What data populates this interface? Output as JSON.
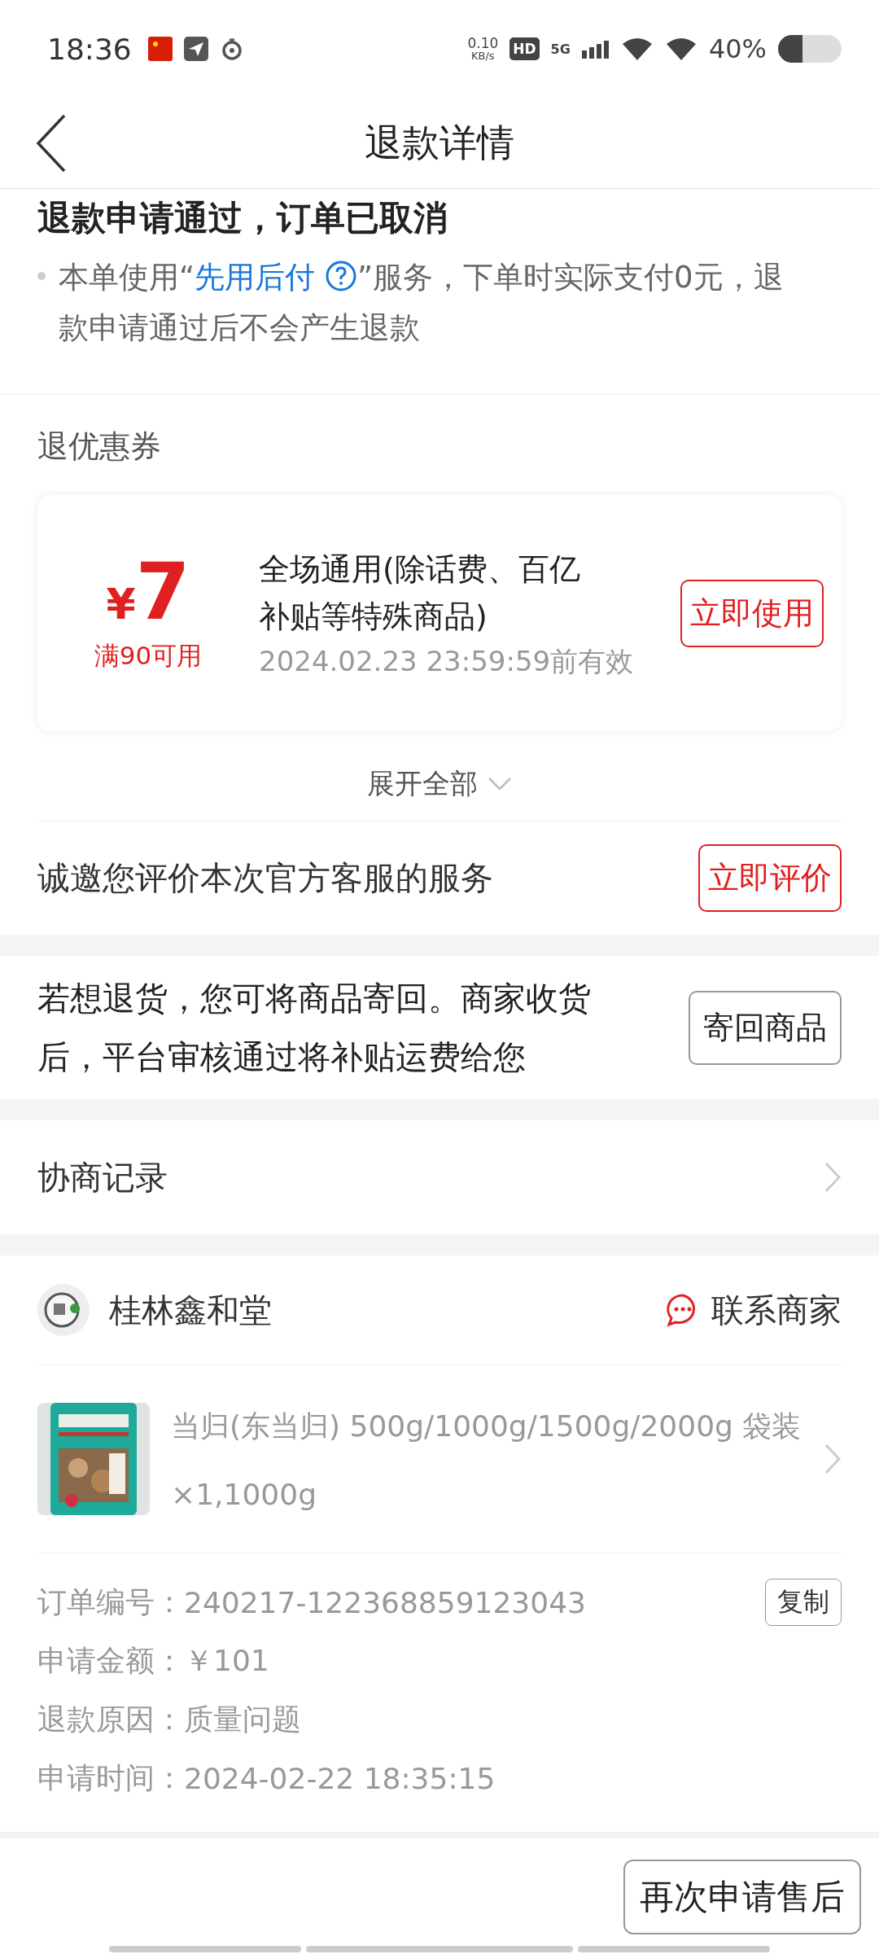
{
  "status_bar": {
    "time": "18:36",
    "net_speed": "0.10",
    "net_unit": "KB/s",
    "hd": "HD",
    "network": "5G",
    "battery": "40%"
  },
  "nav": {
    "title": "退款详情"
  },
  "status_heading": "退款申请通过，订单已取消",
  "notice": {
    "before": "本单使用“",
    "link": "先用后付",
    "after": "”服务，下单时实际支付0元，退款申请通过后不会产生退款"
  },
  "coupons": {
    "title": "退优惠券",
    "items": [
      {
        "symbol": "¥",
        "amount": "7",
        "condition": "满90可用",
        "description": "全场通用(除话费、百亿补贴等特殊商品)",
        "validity": "2024.02.23 23:59:59前有效",
        "action": "立即使用"
      }
    ],
    "expand": "展开全部"
  },
  "rating": {
    "text": "诚邀您评价本次官方客服的服务",
    "action": "立即评价"
  },
  "return_hint": {
    "text": "若想退货，您可将商品寄回。商家收货后，平台审核通过将补贴运费给您",
    "action": "寄回商品"
  },
  "negotiation": {
    "label": "协商记录"
  },
  "shop": {
    "name": "桂林鑫和堂",
    "contact": "联系商家"
  },
  "product": {
    "title": "当归(东当归) 500g/1000g/1500g/2000g 袋装",
    "quantity": "×1,1000g"
  },
  "order_info": {
    "rows": [
      {
        "label": "订单编号：",
        "value": "240217-122368859123043",
        "action": "复制"
      },
      {
        "label": "申请金额：",
        "value": "￥101"
      },
      {
        "label": "退款原因：",
        "value": "质量问题"
      },
      {
        "label": "申请时间：",
        "value": "2024-02-22 18:35:15"
      }
    ]
  },
  "footer": {
    "action": "再次申请售后"
  }
}
